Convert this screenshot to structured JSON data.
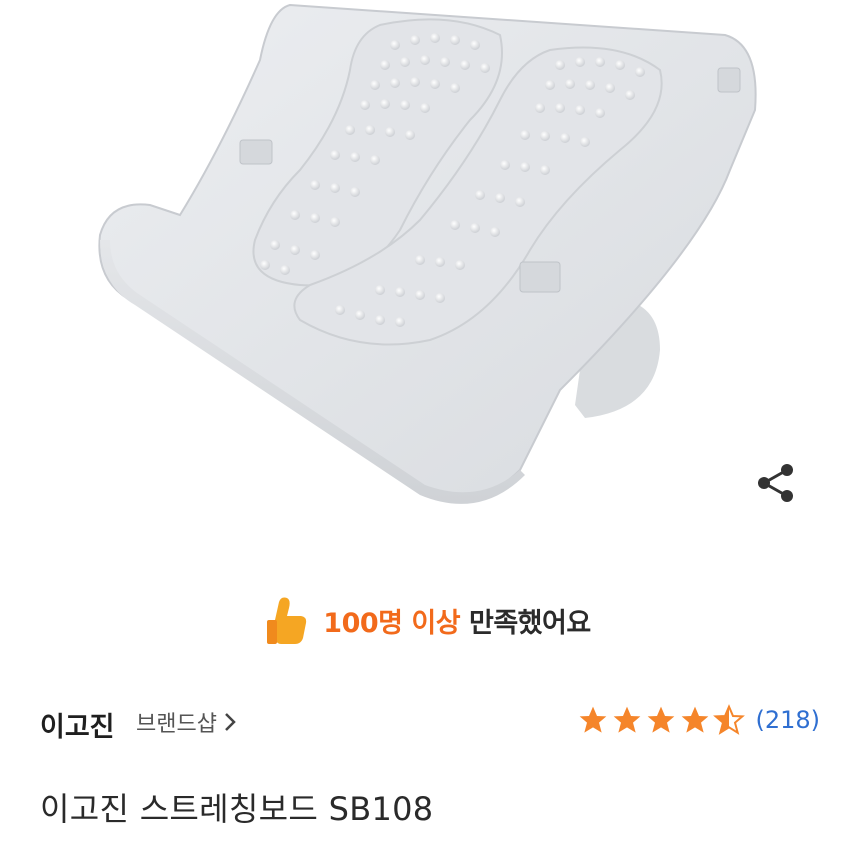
{
  "product": {
    "image_alt": "stretching board product image",
    "title": "이고진 스트레칭보드 SB108"
  },
  "share": {
    "icon": "share-icon"
  },
  "satisfaction": {
    "icon": "thumbs-up-icon",
    "highlight": "100명 이상",
    "rest": "만족했어요",
    "accent_color": "#f26a1b"
  },
  "brand": {
    "name": "이고진",
    "shop_label": "브랜드샵",
    "chevron_icon": "chevron-right-icon"
  },
  "rating": {
    "stars": 4.5,
    "max_stars": 5,
    "review_count": "(218)",
    "star_color": "#f5852a"
  }
}
